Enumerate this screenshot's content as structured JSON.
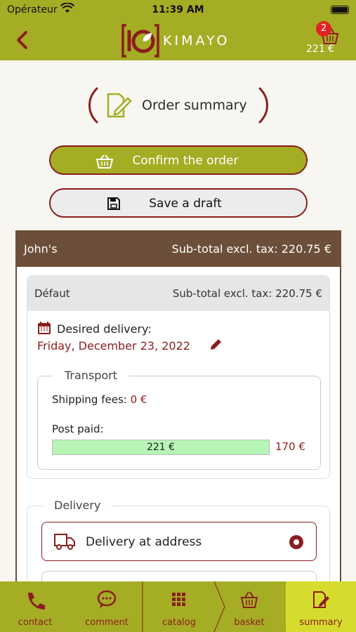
{
  "status_bar": {
    "carrier": "Opérateur",
    "time": "11:39 AM"
  },
  "header": {
    "brand": "KIMAYO",
    "cart_count": "2",
    "cart_total": "221 €"
  },
  "page": {
    "title": "Order summary"
  },
  "actions": {
    "confirm_label": "Confirm the order",
    "draft_label": "Save a draft"
  },
  "order": {
    "customer": "John's",
    "customer_subtotal": "Sub-total excl. tax: 220.75 €",
    "section_name": "Défaut",
    "section_subtotal": "Sub-total excl. tax: 220.75 €",
    "desired_delivery_label": "Desired delivery:",
    "desired_delivery_date": "Friday, December 23, 2022",
    "transport": {
      "legend": "Transport",
      "shipping_label": "Shipping fees: ",
      "shipping_value": "0 €",
      "post_paid_label": "Post paid:",
      "post_paid_value": "221 €",
      "post_paid_threshold": "170 €",
      "post_paid_fill_fraction": 1.0
    },
    "delivery": {
      "legend": "Delivery",
      "options": [
        {
          "label": "Delivery at address",
          "selected": true
        },
        {
          "label": "",
          "selected": false
        }
      ]
    }
  },
  "bottom_nav": [
    {
      "label": "contact",
      "icon": "phone-icon"
    },
    {
      "label": "comment",
      "icon": "speech-bubble-icon"
    },
    {
      "label": "catalog",
      "icon": "grid-icon"
    },
    {
      "label": "basket",
      "icon": "basket-icon"
    },
    {
      "label": "summary",
      "icon": "edit-note-icon",
      "active": true
    }
  ],
  "colors": {
    "brand_olive": "#a5ad24",
    "accent_red": "#8b1e1e",
    "card_brown": "#6b4f3a",
    "progress_green": "#b6f5b6"
  }
}
